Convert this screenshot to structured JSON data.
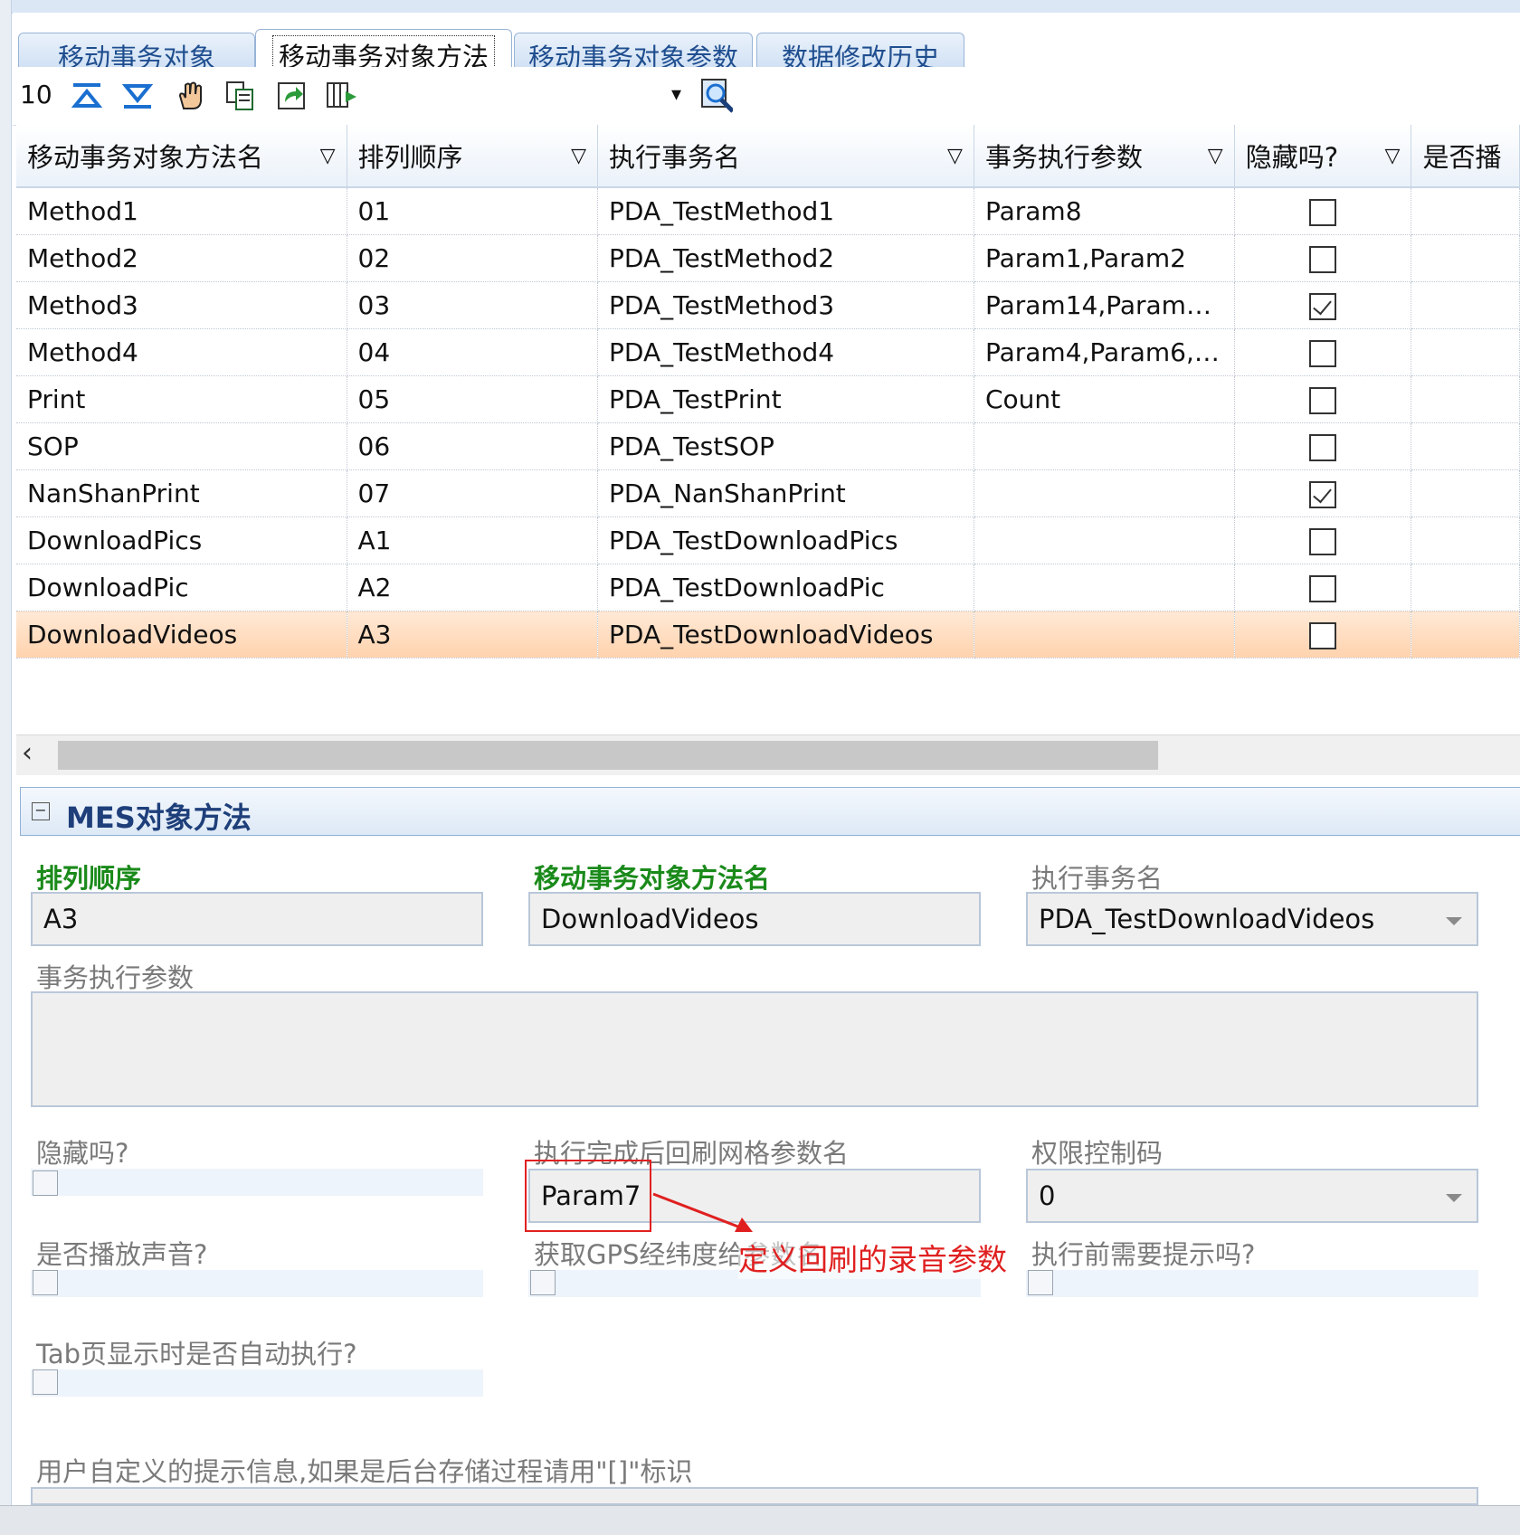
{
  "tabs": [
    {
      "label": "移动事务对象"
    },
    {
      "label": "移动事务对象方法"
    },
    {
      "label": "移动事务对象参数"
    },
    {
      "label": "数据修改历史"
    }
  ],
  "toolbar": {
    "page_size": "10",
    "icons": [
      "move-top-icon",
      "move-bottom-icon",
      "hand-icon",
      "copy-icon",
      "export-icon",
      "column-add-icon",
      "dropdown-arrow-icon",
      "search-icon"
    ]
  },
  "grid": {
    "columns": [
      "移动事务对象方法名",
      "排列顺序",
      "执行事务名",
      "事务执行参数",
      "隐藏吗?",
      "是否播"
    ],
    "rows": [
      {
        "name": "Method1",
        "order": "01",
        "proc": "PDA_TestMethod1",
        "params": "Param8",
        "hidden": false
      },
      {
        "name": "Method2",
        "order": "02",
        "proc": "PDA_TestMethod2",
        "params": "Param1,Param2",
        "hidden": false
      },
      {
        "name": "Method3",
        "order": "03",
        "proc": "PDA_TestMethod3",
        "params": "Param14,Param…",
        "hidden": true
      },
      {
        "name": "Method4",
        "order": "04",
        "proc": "PDA_TestMethod4",
        "params": "Param4,Param6,…",
        "hidden": false
      },
      {
        "name": "Print",
        "order": "05",
        "proc": "PDA_TestPrint",
        "params": "Count",
        "hidden": false
      },
      {
        "name": "SOP",
        "order": "06",
        "proc": "PDA_TestSOP",
        "params": "",
        "hidden": false
      },
      {
        "name": "NanShanPrint",
        "order": "07",
        "proc": "PDA_NanShanPrint",
        "params": "",
        "hidden": true
      },
      {
        "name": "DownloadPics",
        "order": "A1",
        "proc": "PDA_TestDownloadPics",
        "params": "",
        "hidden": false
      },
      {
        "name": "DownloadPic",
        "order": "A2",
        "proc": "PDA_TestDownloadPic",
        "params": "",
        "hidden": false
      },
      {
        "name": "DownloadVideos",
        "order": "A3",
        "proc": "PDA_TestDownloadVideos",
        "params": "",
        "hidden": false
      }
    ],
    "selected_row": 9
  },
  "group": {
    "title": "MES对象方法"
  },
  "form": {
    "order_label": "排列顺序",
    "order_value": "A3",
    "name_label": "移动事务对象方法名",
    "name_value": "DownloadVideos",
    "proc_label": "执行事务名",
    "proc_value": "PDA_TestDownloadVideos",
    "params_label": "事务执行参数",
    "params_value": "",
    "hidden_label": "隐藏吗?",
    "refresh_label": "执行完成后回刷网格参数名",
    "refresh_value": "Param7",
    "perm_label": "权限控制码",
    "perm_value": "0",
    "sound_label": "是否播放声音?",
    "gps_label": "获取GPS经纬度给参数名",
    "confirm_label": "执行前需要提示吗?",
    "autorun_label": "Tab页显示时是否自动执行?",
    "prompt_label": "用户自定义的提示信息,如果是后台存储过程请用\"[]\"标识"
  },
  "annotation": {
    "text": "定义回刷的录音参数",
    "color": "#e02020"
  },
  "colors": {
    "selected_row": "#ffd9b8",
    "required_label": "#1a8a1a",
    "group_title": "#1e3f7a"
  }
}
